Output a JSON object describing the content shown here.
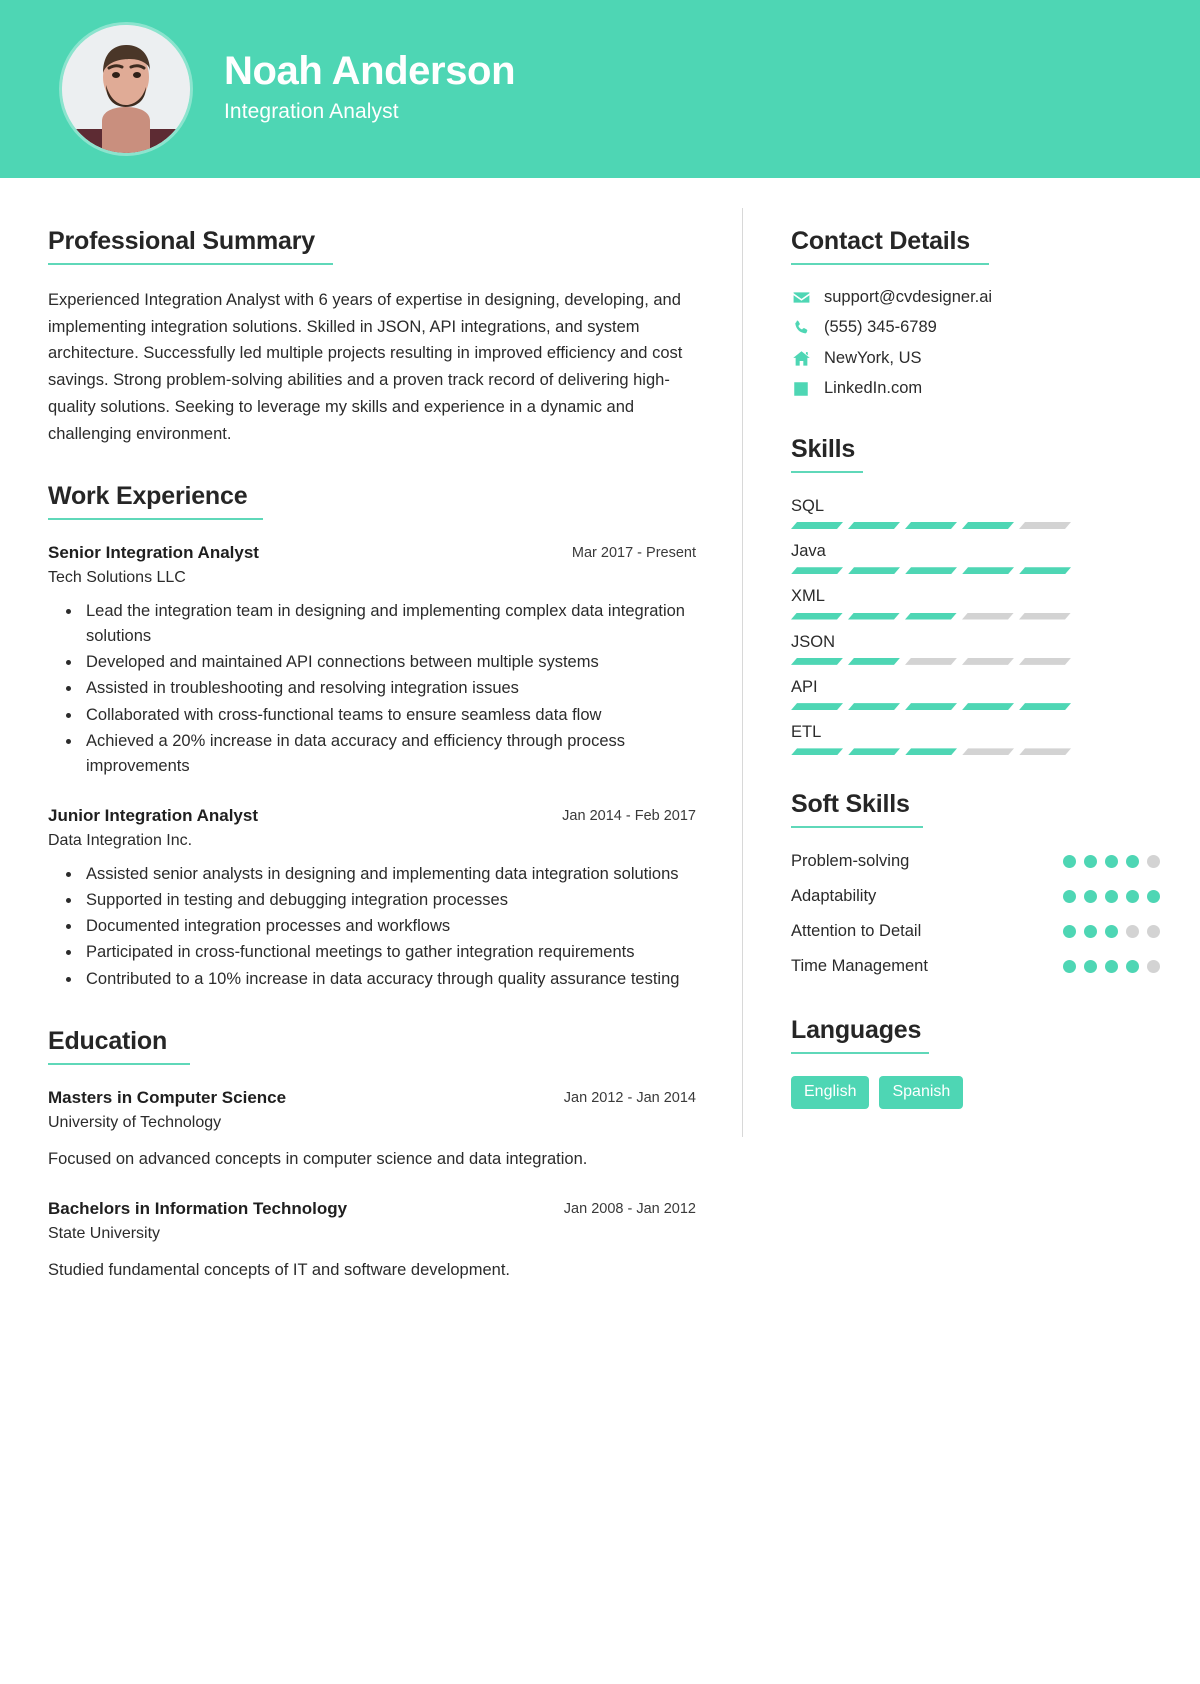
{
  "theme": {
    "accent": "#4ed6b4",
    "accent_rule": "#5fd8b9",
    "muted_bar": "#d3d3d3",
    "text": "#2b2b2b"
  },
  "header": {
    "name": "Noah Anderson",
    "role": "Integration Analyst",
    "avatar_icon": "person-photo"
  },
  "left": {
    "summary_section": {
      "title": "Professional Summary",
      "text": "Experienced Integration Analyst with 6 years of expertise in designing, developing, and implementing integration solutions. Skilled in JSON, API integrations, and system architecture. Successfully led multiple projects resulting in improved efficiency and cost savings. Strong problem-solving abilities and a proven track record of delivering high-quality solutions. Seeking to leverage my skills and experience in a dynamic and challenging environment."
    },
    "experience_section": {
      "title": "Work Experience",
      "entries": [
        {
          "title": "Senior Integration Analyst",
          "date": "Mar 2017 - Present",
          "org": "Tech Solutions LLC",
          "bullets": [
            "Lead the integration team in designing and implementing complex data integration solutions",
            "Developed and maintained API connections between multiple systems",
            "Assisted in troubleshooting and resolving integration issues",
            "Collaborated with cross-functional teams to ensure seamless data flow",
            "Achieved a 20% increase in data accuracy and efficiency through process improvements"
          ]
        },
        {
          "title": "Junior Integration Analyst",
          "date": "Jan 2014 - Feb 2017",
          "org": "Data Integration Inc.",
          "bullets": [
            "Assisted senior analysts in designing and implementing data integration solutions",
            "Supported in testing and debugging integration processes",
            "Documented integration processes and workflows",
            "Participated in cross-functional meetings to gather integration requirements",
            "Contributed to a 10% increase in data accuracy through quality assurance testing"
          ]
        }
      ]
    },
    "education_section": {
      "title": "Education",
      "entries": [
        {
          "title": "Masters in Computer Science",
          "date": "Jan 2012 - Jan 2014",
          "org": "University of Technology",
          "desc": "Focused on advanced concepts in computer science and data integration."
        },
        {
          "title": "Bachelors in Information Technology",
          "date": "Jan 2008 - Jan 2012",
          "org": "State University",
          "desc": "Studied fundamental concepts of IT and software development."
        }
      ]
    }
  },
  "right": {
    "contact_section": {
      "title": "Contact Details",
      "items": [
        {
          "icon": "envelope-icon",
          "value": "support@cvdesigner.ai"
        },
        {
          "icon": "phone-icon",
          "value": "(555) 345-6789"
        },
        {
          "icon": "home-icon",
          "value": "NewYork, US"
        },
        {
          "icon": "linkedin-icon",
          "value": "LinkedIn.com"
        }
      ]
    },
    "skills_section": {
      "title": "Skills",
      "total_segments": 5,
      "items": [
        {
          "name": "SQL",
          "filled": 4
        },
        {
          "name": "Java",
          "filled": 5
        },
        {
          "name": "XML",
          "filled": 3
        },
        {
          "name": "JSON",
          "filled": 2
        },
        {
          "name": "API",
          "filled": 5
        },
        {
          "name": "ETL",
          "filled": 3
        }
      ]
    },
    "soft_skills_section": {
      "title": "Soft Skills",
      "total_dots": 5,
      "items": [
        {
          "name": "Problem-solving",
          "filled": 4
        },
        {
          "name": "Adaptability",
          "filled": 5
        },
        {
          "name": "Attention to Detail",
          "filled": 3
        },
        {
          "name": "Time Management",
          "filled": 4
        }
      ]
    },
    "languages_section": {
      "title": "Languages",
      "items": [
        "English",
        "Spanish"
      ]
    }
  }
}
